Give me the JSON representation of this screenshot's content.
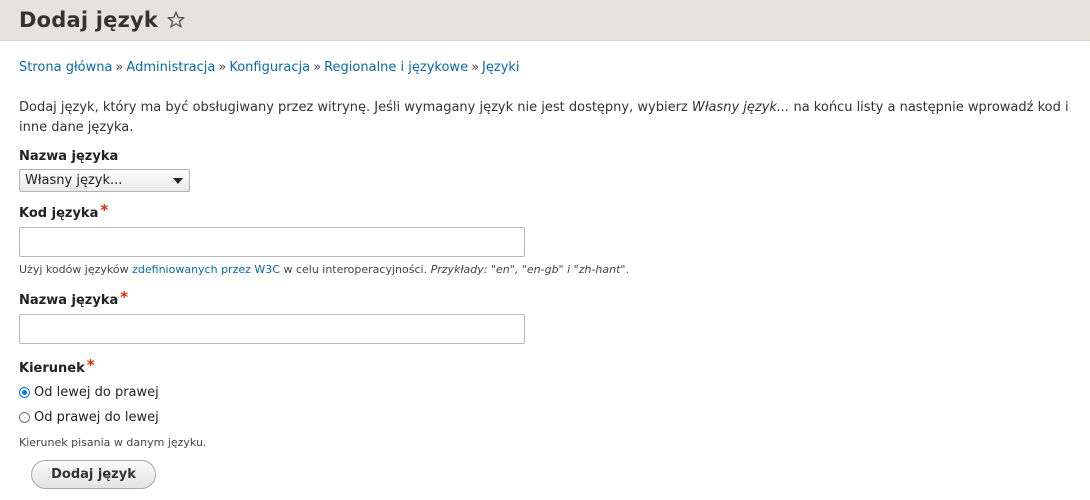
{
  "header": {
    "title": "Dodaj język",
    "star_icon": "star-outline-icon"
  },
  "breadcrumb": [
    {
      "label": "Strona główna"
    },
    {
      "label": "Administracja"
    },
    {
      "label": "Konfiguracja"
    },
    {
      "label": "Regionalne i językowe"
    },
    {
      "label": "Języki"
    }
  ],
  "breadcrumb_separator": "»",
  "intro": {
    "part1": "Dodaj język, który ma być obsługiwany przez witrynę. Jeśli wymagany język nie jest dostępny, wybierz ",
    "em": "Własny język...",
    "part2": " na końcu listy a następnie wprowadź kod i inne dane języka."
  },
  "form": {
    "language_select": {
      "label": "Nazwa języka",
      "selected": "Własny język..."
    },
    "langcode": {
      "label": "Kod języka",
      "required_mark": "*",
      "value": "",
      "desc_part1": "Użyj kodów języków ",
      "desc_link": "zdefiniowanych przez W3C",
      "desc_part2": " w celu interoperacyjności. ",
      "desc_em": "Przykłady: \"en\", \"en-gb\" i \"zh-hant\"",
      "desc_end": "."
    },
    "label_field": {
      "label": "Nazwa języka",
      "required_mark": "*",
      "value": ""
    },
    "direction": {
      "label": "Kierunek",
      "required_mark": "*",
      "options": [
        {
          "label": "Od lewej do prawej",
          "checked": true
        },
        {
          "label": "Od prawej do lewej",
          "checked": false
        }
      ],
      "description": "Kierunek pisania w danym języku."
    },
    "submit_label": "Dodaj język"
  },
  "colors": {
    "link": "#0a6aa8",
    "required": "#e32700",
    "header_bg": "#e5e3dc"
  }
}
